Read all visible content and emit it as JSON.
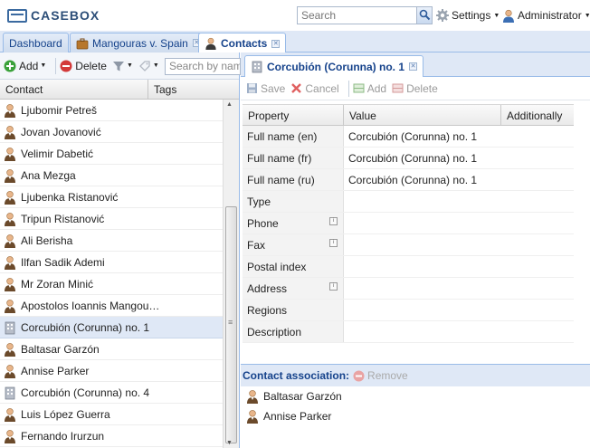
{
  "app": {
    "logo_text": "CASEBOX"
  },
  "header": {
    "search_placeholder": "Search",
    "settings_label": "Settings",
    "user_label": "Administrator"
  },
  "tabs": [
    {
      "label": "Dashboard"
    },
    {
      "label": "Mangouras v. Spain"
    },
    {
      "label": "Contacts"
    }
  ],
  "left_toolbar": {
    "add_label": "Add",
    "delete_label": "Delete",
    "search_placeholder": "Search by name"
  },
  "left_grid": {
    "columns": [
      "Contact",
      "Tags"
    ],
    "rows": [
      {
        "name": "Ljubomir Petreš",
        "icon": "person-icon"
      },
      {
        "name": "Jovan Jovanović",
        "icon": "person-icon"
      },
      {
        "name": "Velimir Dabetić",
        "icon": "person-icon"
      },
      {
        "name": "Ana Mezga",
        "icon": "person-icon"
      },
      {
        "name": "Ljubenka Ristanović",
        "icon": "person-icon"
      },
      {
        "name": "Tripun Ristanović",
        "icon": "person-icon"
      },
      {
        "name": "Ali Berisha",
        "icon": "person-icon"
      },
      {
        "name": "Ilfan Sadik Ademi",
        "icon": "person-icon"
      },
      {
        "name": "Mr Zoran Minić",
        "icon": "person-icon"
      },
      {
        "name": "Apostolos Ioannis Mangou…",
        "icon": "person-icon"
      },
      {
        "name": "Corcubión (Corunna) no. 1",
        "icon": "building-icon",
        "selected": true
      },
      {
        "name": "Baltasar Garzón",
        "icon": "person-icon"
      },
      {
        "name": "Annise Parker",
        "icon": "person-icon"
      },
      {
        "name": "Corcubión (Corunna) no. 4",
        "icon": "building-icon"
      },
      {
        "name": "Luis López Guerra",
        "icon": "person-icon"
      },
      {
        "name": "Fernando Irurzun",
        "icon": "person-icon"
      }
    ]
  },
  "detail": {
    "tab_title": "Corcubión (Corunna) no. 1",
    "toolbar": {
      "save_label": "Save",
      "cancel_label": "Cancel",
      "add_label": "Add",
      "delete_label": "Delete"
    },
    "columns": [
      "Property",
      "Value",
      "Additionally"
    ],
    "properties": [
      {
        "property": "Full name (en)",
        "value": "Corcubión (Corunna) no. 1",
        "info": false
      },
      {
        "property": "Full name (fr)",
        "value": "Corcubión (Corunna) no. 1",
        "info": false
      },
      {
        "property": "Full name (ru)",
        "value": "Corcubión (Corunna) no. 1",
        "info": false
      },
      {
        "property": "Type",
        "value": "",
        "info": false
      },
      {
        "property": "Phone",
        "value": "",
        "info": true
      },
      {
        "property": "Fax",
        "value": "",
        "info": true
      },
      {
        "property": "Postal index",
        "value": "",
        "info": false
      },
      {
        "property": "Address",
        "value": "",
        "info": true
      },
      {
        "property": "Regions",
        "value": "",
        "info": false
      },
      {
        "property": "Description",
        "value": "",
        "info": false
      }
    ],
    "association": {
      "title": "Contact association:",
      "remove_label": "Remove",
      "items": [
        "Baltasar Garzón",
        "Annise Parker"
      ]
    }
  }
}
